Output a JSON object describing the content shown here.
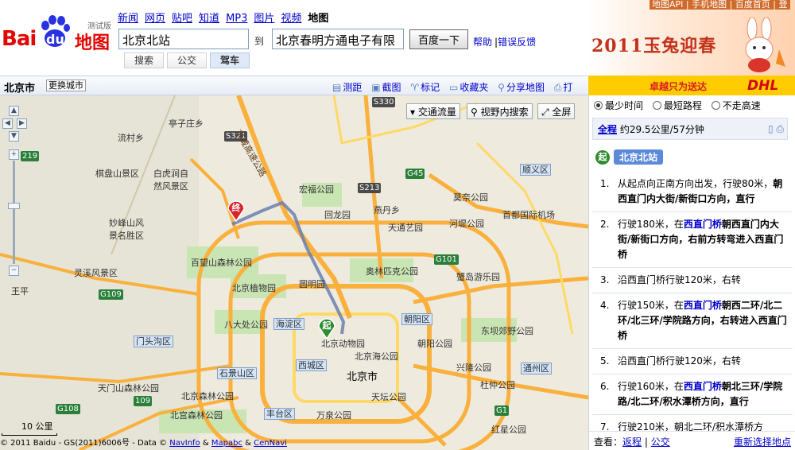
{
  "logo": {
    "bai": "Bai",
    "du": "du",
    "map": "地图",
    "beta": "测试版"
  },
  "topnav": {
    "items": [
      "新闻",
      "网页",
      "贴吧",
      "知道",
      "MP3",
      "图片",
      "视频"
    ],
    "current": "地图"
  },
  "search": {
    "from": "北京北站",
    "to_label": "到",
    "to": "北京春明方通电子有限",
    "button": "百度一下",
    "help": "帮助",
    "sep": "|",
    "feedback": "错误反馈"
  },
  "modes": {
    "bus_search": "搜索",
    "transit": "公交",
    "drive": "驾车"
  },
  "banner": {
    "links": "地图API | 手机地图 | 百度首页 | 登",
    "slogan": "2011玉兔迎春"
  },
  "toolbar": {
    "city": "北京市",
    "switch_city": "更换城市",
    "tools": [
      "测距",
      "截图",
      "标记",
      "收藏夹",
      "分享地图",
      "打印"
    ]
  },
  "ad": {
    "text": "卓越只为送达",
    "brand": "DHL"
  },
  "map": {
    "controls": {
      "traffic": "交通流量",
      "view_search": "视野内搜索",
      "fullscreen": "全屏"
    },
    "labels": [
      {
        "t": "亭子庄乡"
      },
      {
        "t": "流村乡"
      },
      {
        "t": "棋盘山景区"
      },
      {
        "t": "白虎涧自然风景区"
      },
      {
        "t": "妙峰山风景名胜区"
      },
      {
        "t": "灵溪风景区"
      },
      {
        "t": "王平"
      },
      {
        "t": "宏福公园"
      },
      {
        "t": "回龙园"
      },
      {
        "t": "燕丹乡"
      },
      {
        "t": "天通艺园"
      },
      {
        "t": "莫奈公园"
      },
      {
        "t": "河堤公园"
      },
      {
        "t": "首都国际机场"
      },
      {
        "t": "百望山森林公园"
      },
      {
        "t": "北京植物园"
      },
      {
        "t": "圆明园"
      },
      {
        "t": "奥林匹克公园"
      },
      {
        "t": "蟹岛游乐园"
      },
      {
        "t": "八大处公园"
      },
      {
        "t": "北京动物园"
      },
      {
        "t": "北京海公园"
      },
      {
        "t": "朝阳公园"
      },
      {
        "t": "东坝郊野公园"
      },
      {
        "t": "北京市"
      },
      {
        "t": "兴隆公园"
      },
      {
        "t": "杜仲公园"
      },
      {
        "t": "天门山森林公园"
      },
      {
        "t": "北宫森林公园"
      },
      {
        "t": "北京森林公园"
      },
      {
        "t": "天坛公园"
      },
      {
        "t": "万泉公园"
      },
      {
        "t": "红星公园"
      },
      {
        "t": "顺义区"
      }
    ],
    "districts": [
      {
        "t": "海淀区"
      },
      {
        "t": "朝阳区"
      },
      {
        "t": "门头沟区"
      },
      {
        "t": "西城区"
      },
      {
        "t": "石景山区"
      },
      {
        "t": "丰台区"
      },
      {
        "t": "通州区"
      }
    ],
    "roads": [
      "S330",
      "S321",
      "219",
      "G45",
      "S213",
      "G101",
      "G109",
      "G108",
      "G1",
      "109"
    ],
    "expressway": "京藏高速公路",
    "pin_end": "终",
    "pin_start": "起",
    "scale": "10 公里",
    "copyright_prefix": "© 2011 Baidu - GS(2011)6006号 - Data ©",
    "copyright_links": [
      "NavInfo",
      "&",
      "Mapabc",
      "&",
      "CenNavi"
    ]
  },
  "panel": {
    "options": [
      "最少时间",
      "最短路程",
      "不走高速"
    ],
    "summary_link": "全程",
    "summary_text": "约29.5公里/57分钟",
    "start_badge": "起",
    "start_name": "北京北站",
    "steps": [
      {
        "n": "1.",
        "pre": "从起点向正南方向出发，行驶80米，",
        "hl": "",
        "post": "朝西直门内大街/新街口方向，直行"
      },
      {
        "n": "2.",
        "pre": "行驶180米，在",
        "hl": "西直门桥",
        "post": "朝西直门内大街/新街口方向，右前方转弯进入西直门桥"
      },
      {
        "n": "3.",
        "pre": "沿西直门桥行驶120米，右转",
        "hl": "",
        "post": ""
      },
      {
        "n": "4.",
        "pre": "行驶150米，在",
        "hl": "西直门桥",
        "post": "朝西二环/北二环/北三环/学院路方向，右转进入西直门桥"
      },
      {
        "n": "5.",
        "pre": "沿西直门桥行驶120米，右转",
        "hl": "",
        "post": ""
      },
      {
        "n": "6.",
        "pre": "行驶160米，在",
        "hl": "西直门桥",
        "post": "朝北三环/学院路/北二环/积水潭桥方向，直行"
      },
      {
        "n": "7.",
        "pre": "行驶210米，朝北二环/积水潭桥方",
        "hl": "",
        "post": ""
      }
    ],
    "footer_label": "查看：",
    "footer_links": [
      "返程",
      "公交"
    ],
    "footer_right": "重新选择地点"
  },
  "colors": {
    "brand_red": "#e10602",
    "link": "#0000cc",
    "route": "#6b7fae",
    "highway": "#f9b03c",
    "park": "#b7dca0"
  }
}
